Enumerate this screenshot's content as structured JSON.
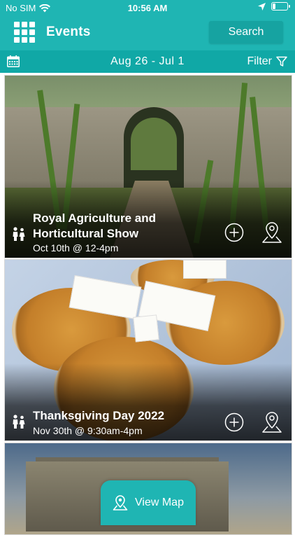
{
  "status_bar": {
    "carrier": "No SIM",
    "time": "10:56 AM"
  },
  "header": {
    "title": "Events",
    "search_label": "Search"
  },
  "date_bar": {
    "range": "Aug 26  -  Jul 1",
    "filter_label": "Filter"
  },
  "events": [
    {
      "title": "Royal Agriculture and Horticultural Show",
      "time": "Oct 10th @ 12-4pm"
    },
    {
      "title": "Thanksgiving Day 2022",
      "time": "Nov 30th @ 9:30am-4pm"
    }
  ],
  "bottom": {
    "view_map_label": "View Map"
  },
  "colors": {
    "accent": "#1fb5b3",
    "accent_dark": "#10a8a6"
  }
}
